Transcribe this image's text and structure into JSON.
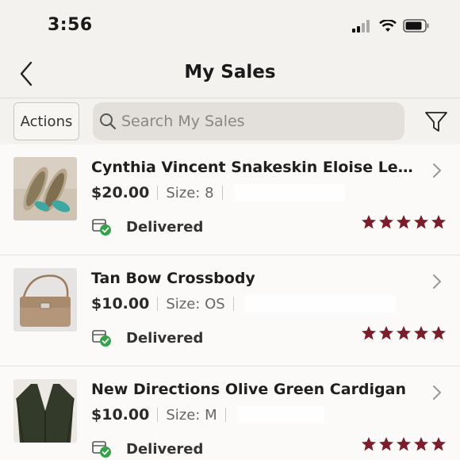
{
  "status_bar": {
    "time": "3:56"
  },
  "header": {
    "title": "My Sales"
  },
  "toolbar": {
    "actions_label": "Actions",
    "search_placeholder": "Search My Sales"
  },
  "colors": {
    "star": "#7a1e2c",
    "delivered_check": "#33a34a",
    "background": "#fbfaf8"
  },
  "sales": [
    {
      "title": "Cynthia Vincent Snakeskin Eloise Leather...",
      "price": "$20.00",
      "size": "Size: 8",
      "status": "Delivered",
      "rating": 5
    },
    {
      "title": "Tan Bow Crossbody",
      "price": "$10.00",
      "size": "Size: OS",
      "status": "Delivered",
      "rating": 5
    },
    {
      "title": "New Directions Olive Green Cardigan",
      "price": "$10.00",
      "size": "Size: M",
      "status": "Delivered",
      "rating": 5
    }
  ]
}
